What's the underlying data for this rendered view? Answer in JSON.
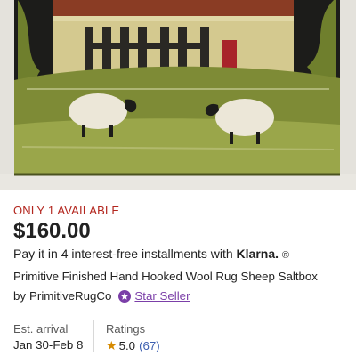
{
  "product_image": {
    "description": "hooked-rug-sheep-saltbox-photo"
  },
  "availability": "ONLY 1 AVAILABLE",
  "price": "$160.00",
  "installments": {
    "text": "Pay it in 4 interest-free installments with",
    "provider": "Klarna.",
    "info_symbol": "®"
  },
  "title": "Primitive Finished Hand Hooked Wool Rug Sheep Saltbox",
  "seller": {
    "by_label": "by",
    "shop_name": "PrimitiveRugCo",
    "badge_label": "Star Seller"
  },
  "arrival": {
    "label": "Est. arrival",
    "value": "Jan 30-Feb 8"
  },
  "ratings": {
    "label": "Ratings",
    "value": "5.0",
    "count": "(67)"
  },
  "colors": {
    "alert": "#b3261e",
    "star_seller": "#7b3fa8",
    "star": "#d68a00",
    "link": "#3d5fb0"
  }
}
